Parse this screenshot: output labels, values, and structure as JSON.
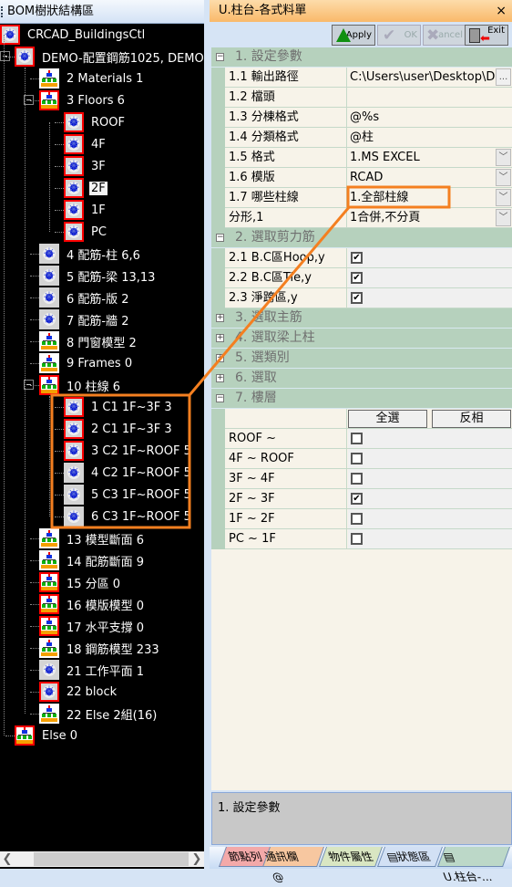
{
  "left_panel": {
    "title": "BOM樹狀結構區",
    "tree": [
      {
        "label": "CRCAD_BuildingsCtl",
        "level": 0,
        "icon": "light",
        "red": true
      },
      {
        "label": "DEMO-配置鋼筋1025, DEMO",
        "level": 1,
        "icon": "light",
        "red": true,
        "expanded": true
      },
      {
        "label": "2 Materials 1",
        "level": 2,
        "icon": "tree",
        "red": false
      },
      {
        "label": "3 Floors 6",
        "level": 2,
        "icon": "tree",
        "red": true,
        "expanded": true
      },
      {
        "label": "ROOF",
        "level": 3,
        "icon": "light",
        "red": true
      },
      {
        "label": "4F",
        "level": 3,
        "icon": "light",
        "red": true
      },
      {
        "label": "3F",
        "level": 3,
        "icon": "light",
        "red": true
      },
      {
        "label": "2F",
        "level": 3,
        "icon": "light",
        "red": true,
        "selected": true
      },
      {
        "label": "1F",
        "level": 3,
        "icon": "light",
        "red": true
      },
      {
        "label": "PC",
        "level": 3,
        "icon": "light",
        "red": true
      },
      {
        "label": "4 配筋-柱 6,6",
        "level": 2,
        "icon": "light",
        "red": false
      },
      {
        "label": "5 配筋-梁 13,13",
        "level": 2,
        "icon": "light",
        "red": false
      },
      {
        "label": "6 配筋-版 2",
        "level": 2,
        "icon": "light",
        "red": false
      },
      {
        "label": "7 配筋-牆 2",
        "level": 2,
        "icon": "light",
        "red": false
      },
      {
        "label": "8 門窗模型 2",
        "level": 2,
        "icon": "tree",
        "red": false
      },
      {
        "label": "9 Frames 0",
        "level": 2,
        "icon": "tree",
        "red": false
      },
      {
        "label": "10 柱線 6",
        "level": 2,
        "icon": "tree",
        "red": true,
        "expanded": true
      },
      {
        "label": "1 C1 1F~3F 3",
        "level": 3,
        "icon": "light",
        "red": true
      },
      {
        "label": "2 C1 1F~3F 3",
        "level": 3,
        "icon": "light",
        "red": true
      },
      {
        "label": "3 C2 1F~ROOF 5",
        "level": 3,
        "icon": "light",
        "red": true
      },
      {
        "label": "4 C2 1F~ROOF 5",
        "level": 3,
        "icon": "light",
        "red": false
      },
      {
        "label": "5 C3 1F~ROOF 5",
        "level": 3,
        "icon": "light",
        "red": false
      },
      {
        "label": "6 C3 1F~ROOF 5",
        "level": 3,
        "icon": "light",
        "red": false
      },
      {
        "label": "13 模型斷面 6",
        "level": 2,
        "icon": "tree",
        "red": false
      },
      {
        "label": "14 配筋斷面 9",
        "level": 2,
        "icon": "tree",
        "red": false
      },
      {
        "label": "15 分區 0",
        "level": 2,
        "icon": "tree",
        "red": true
      },
      {
        "label": "16 模版模型 0",
        "level": 2,
        "icon": "tree",
        "red": true
      },
      {
        "label": "17 水平支撐 0",
        "level": 2,
        "icon": "tree",
        "red": true
      },
      {
        "label": "18 鋼筋模型 233",
        "level": 2,
        "icon": "tree",
        "red": false
      },
      {
        "label": "21 工作平面 1",
        "level": 2,
        "icon": "light",
        "red": false
      },
      {
        "label": "22 block",
        "level": 2,
        "icon": "light",
        "red": true
      },
      {
        "label": "22 Else 2組(16)",
        "level": 2,
        "icon": "tree",
        "red": false
      },
      {
        "label": "Else 0",
        "level": 1,
        "icon": "tree",
        "red": true
      }
    ]
  },
  "right_panel": {
    "title": "U.柱台-各式料單",
    "close_icon": "×",
    "toolbar": {
      "apply": "Apply",
      "ok": "OK",
      "cancel": "Cancel",
      "exit": "Exit"
    },
    "sections": [
      {
        "title": "1. 設定參數",
        "expanded": true,
        "rows": [
          {
            "key": "1.1 輸出路徑",
            "value": "C:\\Users\\user\\Desktop\\D",
            "ellipsis": "..."
          },
          {
            "key": "1.2 檔頭",
            "value": ""
          },
          {
            "key": "1.3 分棟格式",
            "value": "@%s"
          },
          {
            "key": "1.4 分類格式",
            "value": "@柱"
          },
          {
            "key": "1.5 格式",
            "value": "1.MS EXCEL",
            "dropdown": true
          },
          {
            "key": "1.6 模版",
            "value": "RCAD",
            "dropdown": true
          },
          {
            "key": "1.7 哪些柱線",
            "value": "1.全部柱線",
            "dropdown": true
          },
          {
            "key": "分形,1",
            "value": "1合併,不分頁",
            "dropdown": true
          }
        ]
      },
      {
        "title": "2. 選取剪力筋",
        "expanded": true,
        "rows": [
          {
            "key": "2.1 B.C區Hoop,y",
            "checked": true
          },
          {
            "key": "2.2 B.C區Tie,y",
            "checked": true
          },
          {
            "key": "2.3 淨跨區,y",
            "checked": true
          }
        ]
      },
      {
        "title": "3. 選取主筋",
        "expanded": false,
        "rows": []
      },
      {
        "title": "4. 選取梁上柱",
        "expanded": false,
        "rows": []
      },
      {
        "title": "5. 選類別",
        "expanded": false,
        "rows": []
      },
      {
        "title": "6. 選取",
        "expanded": false,
        "rows": []
      },
      {
        "title": "7. 樓層",
        "expanded": true,
        "buttons": [
          "全選",
          "反相"
        ],
        "rows": [
          {
            "key": "ROOF ~",
            "checked": false
          },
          {
            "key": "4F ~ ROOF",
            "checked": false
          },
          {
            "key": "3F ~ 4F",
            "checked": false
          },
          {
            "key": "2F ~ 3F",
            "checked": true
          },
          {
            "key": "1F ~ 2F",
            "checked": false
          },
          {
            "key": "PC ~ 1F",
            "checked": false
          }
        ]
      }
    ],
    "description": "1. 設定參數",
    "tabs": [
      {
        "label": "節點列",
        "color": "#f3a9a9"
      },
      {
        "label": "通訊欄@",
        "color": "#f7c7a0"
      },
      {
        "label": "物件屬性",
        "color": "#d9e6c2"
      },
      {
        "label": "狀態區",
        "color": "#d2e0f4",
        "icon": "document-icon"
      },
      {
        "label": "U.柱台-...",
        "color": "#bcd8c8",
        "icon": "panel-icon",
        "active": true
      }
    ]
  },
  "annotation_color": "#f47f20"
}
